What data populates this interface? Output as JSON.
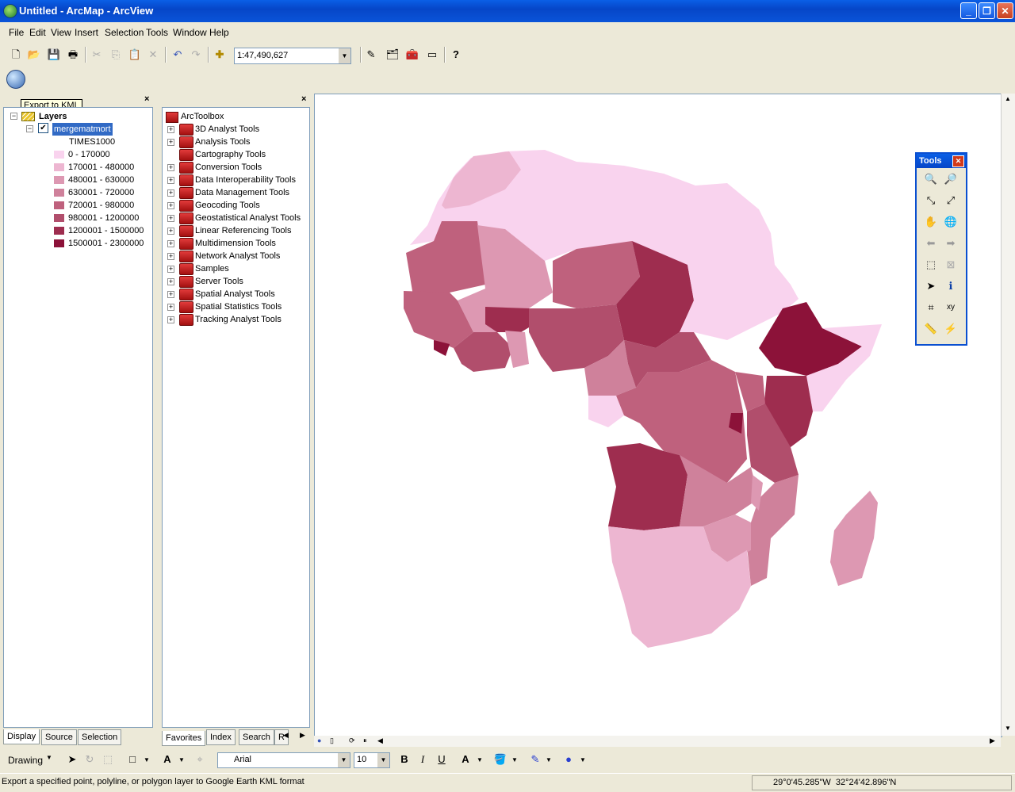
{
  "window": {
    "title": "Untitled - ArcMap - ArcView"
  },
  "menu": [
    "File",
    "Edit",
    "View",
    "Insert",
    "Selection",
    "Tools",
    "Window",
    "Help"
  ],
  "toolbar": {
    "scale": "1:47,490,627"
  },
  "tooltip": "Export to KML",
  "toc": {
    "root": "Layers",
    "layer": "mergematmort",
    "field": "TIMES1000",
    "legend": [
      {
        "label": "0 - 170000",
        "color": "#f9d3ee"
      },
      {
        "label": "170001 - 480000",
        "color": "#edb6d1"
      },
      {
        "label": "480001 - 630000",
        "color": "#dd98b2"
      },
      {
        "label": "630001 - 720000",
        "color": "#cf819b"
      },
      {
        "label": "720001 - 980000",
        "color": "#bf617d"
      },
      {
        "label": "980001 - 1200000",
        "color": "#b14e6c"
      },
      {
        "label": "1200001 - 1500000",
        "color": "#9e2d4f"
      },
      {
        "label": "1500001 - 2300000",
        "color": "#8c1239"
      }
    ],
    "tabs": [
      "Display",
      "Source",
      "Selection"
    ]
  },
  "toolbox": {
    "root": "ArcToolbox",
    "items": [
      "3D Analyst Tools",
      "Analysis Tools",
      "Cartography Tools",
      "Conversion Tools",
      "Data Interoperability Tools",
      "Data Management Tools",
      "Geocoding Tools",
      "Geostatistical Analyst Tools",
      "Linear Referencing Tools",
      "Multidimension Tools",
      "Network Analyst Tools",
      "Samples",
      "Server Tools",
      "Spatial Analyst Tools",
      "Spatial Statistics Tools",
      "Tracking Analyst Tools"
    ],
    "tabs": [
      "Favorites",
      "Index",
      "Search",
      "R"
    ]
  },
  "tools_window": {
    "title": "Tools"
  },
  "drawing": {
    "label": "Drawing",
    "font": "Arial",
    "size": "10"
  },
  "status": {
    "message": "Export a specified point, polyline, or polygon layer to Google Earth KML format",
    "coords": "29°0'45.285\"W  32°24'42.896\"N"
  }
}
